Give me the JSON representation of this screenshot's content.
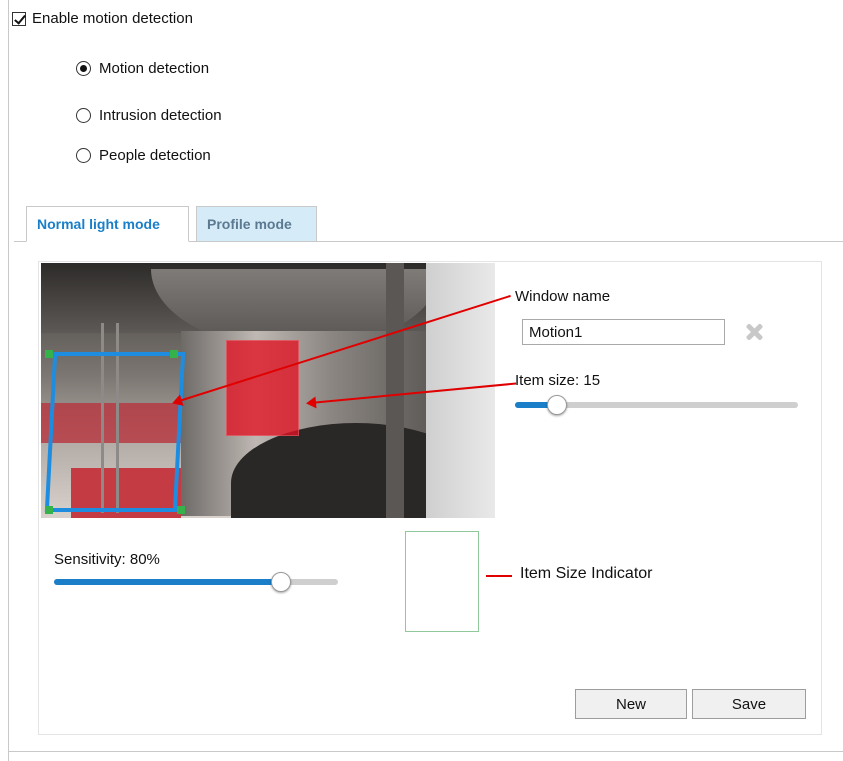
{
  "enable_motion": {
    "label": "Enable motion detection",
    "checked": true
  },
  "detection_modes": [
    {
      "label": "Motion detection",
      "selected": true
    },
    {
      "label": "Intrusion detection",
      "selected": false
    },
    {
      "label": "People detection",
      "selected": false
    }
  ],
  "tabs": [
    {
      "label": "Normal light mode",
      "active": true
    },
    {
      "label": "Profile mode",
      "active": false
    }
  ],
  "window": {
    "name_label": "Window name",
    "name_value": "Motion1"
  },
  "item_size": {
    "label": "Item size: 15",
    "value": 15,
    "fraction": 0.15
  },
  "sensitivity": {
    "label": "Sensitivity: 80%",
    "percent": 80
  },
  "indicator": {
    "label": "Item Size Indicator"
  },
  "buttons": {
    "new": "New",
    "save": "Save"
  },
  "icons": {
    "delete": "delete-x-icon"
  },
  "colors": {
    "accent": "#1a7fc8",
    "annotation": "#e00000",
    "motion_window": "#e11223",
    "indicator_border": "#8fc99b"
  }
}
